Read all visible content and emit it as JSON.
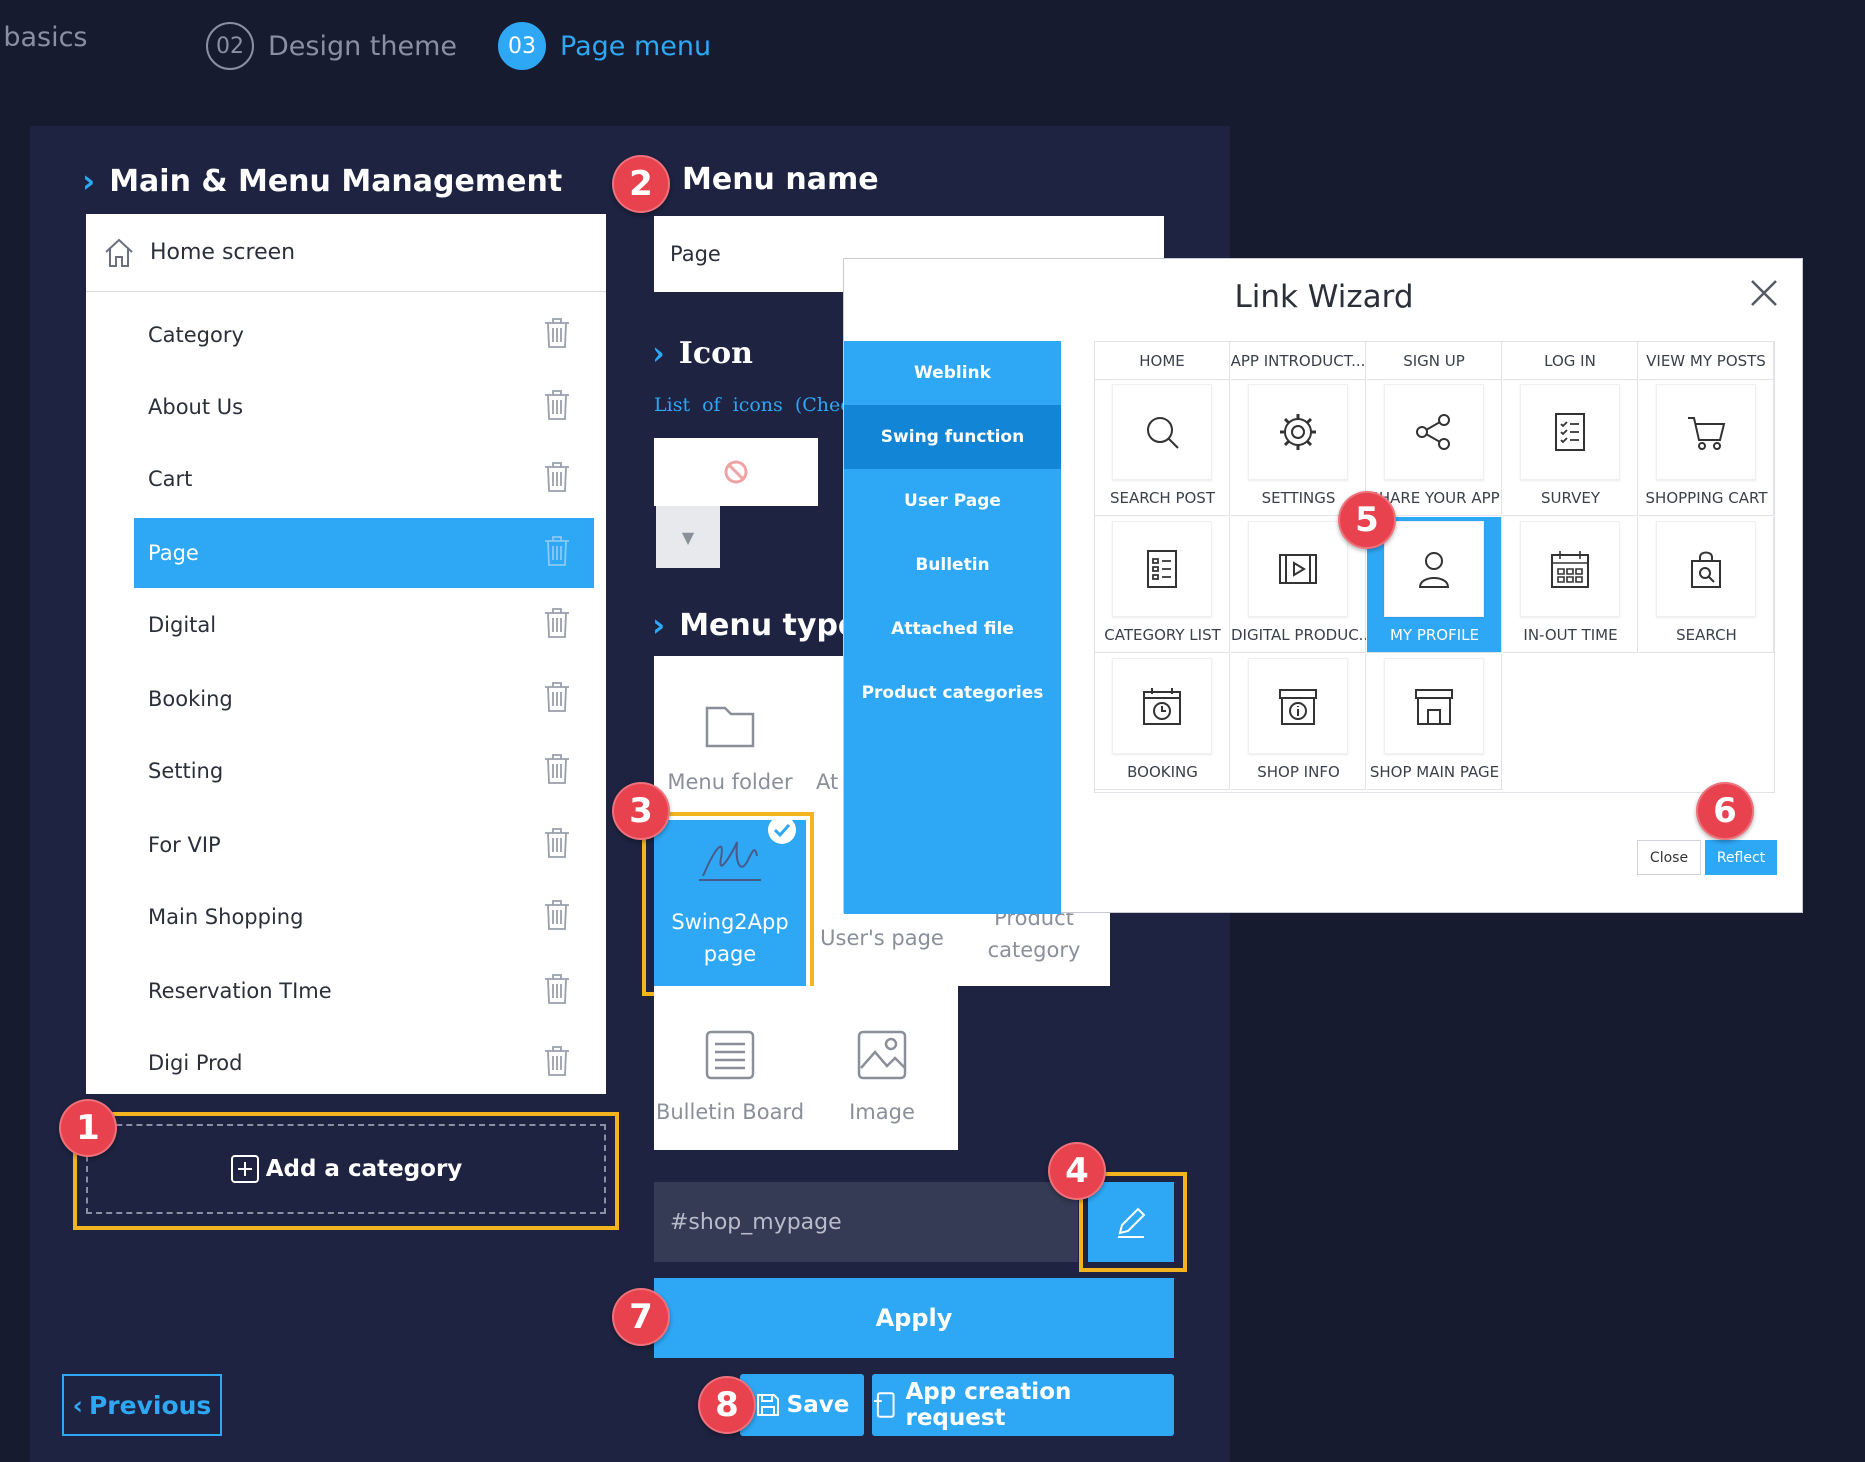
{
  "steps": [
    {
      "num": "",
      "label": "App basics"
    },
    {
      "num": "02",
      "label": "Design theme"
    },
    {
      "num": "03",
      "label": "Page menu"
    }
  ],
  "left": {
    "title": "Main & Menu Management",
    "home": "Home screen",
    "items": [
      "Category",
      "About Us",
      "Cart",
      "Page",
      "Digital",
      "Booking",
      "Setting",
      "For VIP",
      "Main Shopping",
      "Reservation TIme",
      "Digi Prod"
    ],
    "selected_item": "Page",
    "add_category": "Add a category",
    "previous": "Previous"
  },
  "menu_name": {
    "title": "Menu name",
    "value": "Page"
  },
  "icon": {
    "title": "Icon",
    "hint": "List of icons (Check"
  },
  "menu_type": {
    "title": "Menu type",
    "options": [
      "Menu folder",
      "At",
      "Swing2App page",
      "User's page",
      "Product category",
      "Bulletin Board",
      "Image"
    ],
    "selected": "Swing2App page",
    "link_value": "#shop_mypage"
  },
  "buttons": {
    "apply": "Apply",
    "save": "Save",
    "request": "App creation request"
  },
  "badges": [
    "1",
    "2",
    "3",
    "4",
    "5",
    "6",
    "7",
    "8"
  ],
  "wizard": {
    "title": "Link Wizard",
    "tabs": [
      "Weblink",
      "Swing function",
      "User Page",
      "Bulletin",
      "Attached file",
      "Product categories"
    ],
    "selected_tab": "Swing function",
    "headers": [
      "HOME",
      "APP INTRODUCT...",
      "SIGN UP",
      "LOG IN",
      "VIEW MY POSTS"
    ],
    "cells": [
      {
        "label": "SEARCH POST",
        "icon": "search-icon"
      },
      {
        "label": "SETTINGS",
        "icon": "gear-icon"
      },
      {
        "label": "SHARE YOUR APP",
        "icon": "share-icon"
      },
      {
        "label": "SURVEY",
        "icon": "checklist-icon"
      },
      {
        "label": "SHOPPING CART",
        "icon": "cart-icon"
      },
      {
        "label": "CATEGORY LIST",
        "icon": "list-icon"
      },
      {
        "label": "DIGITAL PRODUC...",
        "icon": "film-icon"
      },
      {
        "label": "MY PROFILE",
        "icon": "user-icon"
      },
      {
        "label": "IN-OUT TIME",
        "icon": "calendar-icon"
      },
      {
        "label": "SEARCH",
        "icon": "bag-search-icon"
      },
      {
        "label": "BOOKING",
        "icon": "calendar-clock-icon"
      },
      {
        "label": "SHOP INFO",
        "icon": "shop-info-icon"
      },
      {
        "label": "SHOP MAIN PAGE",
        "icon": "shop-icon"
      }
    ],
    "selected_cell": "MY PROFILE",
    "close": "Close",
    "reflect": "Reflect"
  },
  "colors": {
    "accent": "#2ea7f5",
    "background": "#161b30",
    "panel": "#1d2340",
    "highlight": "#f3b51f",
    "badge": "#e8424f"
  }
}
